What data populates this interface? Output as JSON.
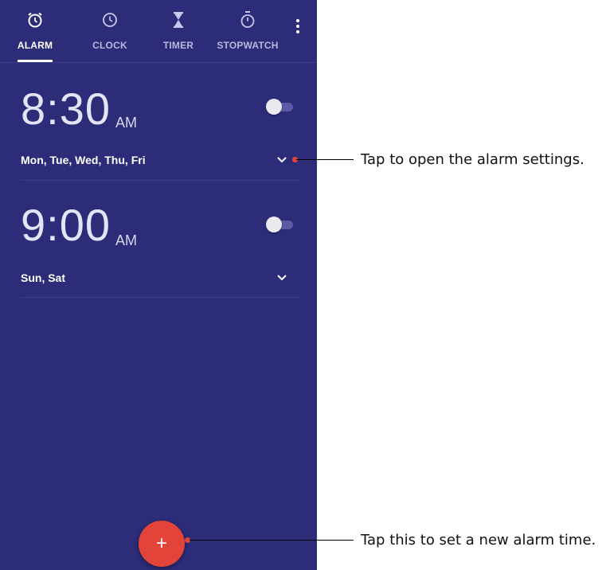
{
  "tabs": [
    {
      "label": "ALARM",
      "icon": "alarm-clock-icon",
      "active": true
    },
    {
      "label": "CLOCK",
      "icon": "clock-icon",
      "active": false
    },
    {
      "label": "TIMER",
      "icon": "hourglass-icon",
      "active": false
    },
    {
      "label": "STOPWATCH",
      "icon": "stopwatch-icon",
      "active": false
    }
  ],
  "alarms": [
    {
      "time": "8:30",
      "ampm": "AM",
      "days": "Mon, Tue, Wed, Thu, Fri",
      "enabled": false
    },
    {
      "time": "9:00",
      "ampm": "AM",
      "days": "Sun, Sat",
      "enabled": false
    }
  ],
  "fab": {
    "label": "+"
  },
  "callouts": {
    "settings": "Tap to open the alarm settings.",
    "new_alarm": "Tap this to set a new alarm time."
  },
  "colors": {
    "background": "#2c2c79",
    "fab": "#e2443a",
    "text": "#ffffff"
  }
}
